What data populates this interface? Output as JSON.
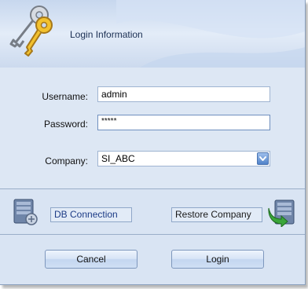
{
  "header": {
    "title": "Login Information",
    "icon": "keys-icon"
  },
  "form": {
    "username": {
      "label": "Username:",
      "value": "admin"
    },
    "password": {
      "label": "Password:",
      "value": "*****"
    },
    "company": {
      "label": "Company:",
      "value": "SI_ABC"
    }
  },
  "links": {
    "db_connection": "DB Connection",
    "restore_company": "Restore Company"
  },
  "buttons": {
    "cancel": "Cancel",
    "login": "Login"
  },
  "colors": {
    "accent": "#4f82c9",
    "link": "#1c3b86",
    "background": "#d9e4f3"
  }
}
